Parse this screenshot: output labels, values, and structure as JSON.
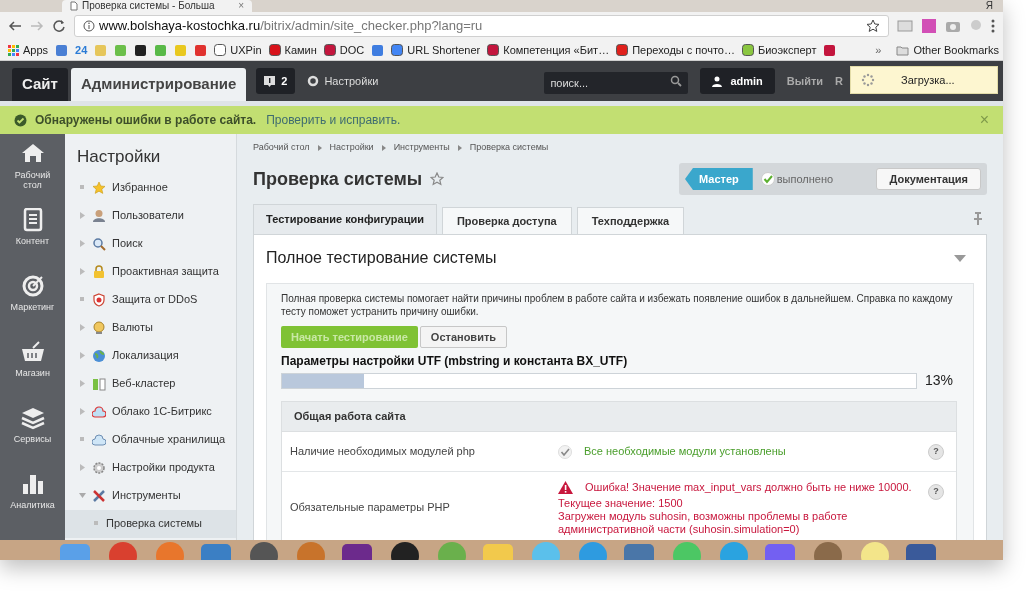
{
  "browser": {
    "tab_title": "Проверка системы - Больша",
    "tab_close": "×",
    "profile_letter": "Я",
    "url_host": "www.bolshaya-kostochka.ru",
    "url_path": "/bitrix/admin/site_checker.php?lang=ru"
  },
  "bookmarks": [
    {
      "kind": "apps",
      "label": "Apps"
    },
    {
      "kind": "icon",
      "color": "#4a7fd4"
    },
    {
      "kind": "text",
      "label": "24",
      "color": "#2a7bd6"
    },
    {
      "kind": "icon",
      "color": "#e6c65a"
    },
    {
      "kind": "icon",
      "color": "#6cbf4a"
    },
    {
      "kind": "icon",
      "color": "#222222"
    },
    {
      "kind": "icon",
      "color": "#59b947"
    },
    {
      "kind": "icon",
      "color": "#e9c81e"
    },
    {
      "kind": "icon",
      "color": "#e0322e"
    },
    {
      "kind": "link",
      "label": "UXPin",
      "color": "#ffffff"
    },
    {
      "kind": "link",
      "label": "Камин",
      "color": "#d8121a"
    },
    {
      "kind": "link",
      "label": "DOC",
      "color": "#c3153d"
    },
    {
      "kind": "icon",
      "color": "#3f7de0"
    },
    {
      "kind": "link",
      "label": "URL Shortener",
      "color": "#4285f4"
    },
    {
      "kind": "link",
      "label": "Компетенция «Бит…",
      "color": "#c3153d"
    },
    {
      "kind": "link",
      "label": "Переходы с почто…",
      "color": "#e0201c"
    },
    {
      "kind": "link",
      "label": "Биоэксперт",
      "color": "#8ac640"
    },
    {
      "kind": "icon",
      "color": "#c3153d"
    }
  ],
  "bookmarks_more": "»",
  "other_bookmarks": "Other Bookmarks",
  "admin_bar": {
    "tabs": [
      {
        "label": "Сайт",
        "selected": false
      },
      {
        "label": "Администрирование",
        "selected": true
      }
    ],
    "notifications": "2",
    "settings": "Настройки",
    "search": {
      "placeholder": "поиск..."
    },
    "user": "admin",
    "logout": "Выйти",
    "cut_text": "R",
    "loading": "Загрузка..."
  },
  "alert": {
    "text": "Обнаружены ошибки в работе сайта.",
    "link": "Проверить и исправить.",
    "close": "×"
  },
  "nav": [
    {
      "kind": "home",
      "label": "Рабочий стол"
    },
    {
      "kind": "content",
      "label": "Контент"
    },
    {
      "kind": "target",
      "label": "Маркетинг"
    },
    {
      "kind": "basket",
      "label": "Магазин"
    },
    {
      "kind": "layers",
      "label": "Сервисы"
    },
    {
      "kind": "chart",
      "label": "Аналитика"
    }
  ],
  "menu": {
    "title": "Настройки",
    "items": [
      {
        "label": "Избранное",
        "kind": "leaf",
        "selected": false
      },
      {
        "label": "Пользователи",
        "kind": "folder",
        "expanded": false,
        "selected": false
      },
      {
        "label": "Поиск",
        "kind": "folder",
        "expanded": false,
        "selected": false
      },
      {
        "label": "Проактивная защита",
        "kind": "folder",
        "expanded": false,
        "selected": false
      },
      {
        "label": "Защита от DDoS",
        "kind": "leaf",
        "selected": false
      },
      {
        "label": "Валюты",
        "kind": "folder",
        "expanded": false,
        "selected": false
      },
      {
        "label": "Локализация",
        "kind": "folder",
        "expanded": false,
        "selected": false
      },
      {
        "label": "Веб-кластер",
        "kind": "folder",
        "expanded": false,
        "selected": false
      },
      {
        "label": "Облако 1С-Битрикс",
        "kind": "folder",
        "expanded": false,
        "selected": false
      },
      {
        "label": "Облачные хранилища",
        "kind": "leaf",
        "selected": false
      },
      {
        "label": "Настройки продукта",
        "kind": "folder",
        "expanded": false,
        "selected": false
      },
      {
        "label": "Инструменты",
        "kind": "folder",
        "expanded": true,
        "selected": false,
        "children": [
          {
            "label": "Проверка системы",
            "kind": "leaf",
            "selected": true
          }
        ]
      }
    ]
  },
  "breadcrumbs": [
    "Рабочий стол",
    "Настройки",
    "Инструменты",
    "Проверка системы"
  ],
  "page_title": "Проверка системы",
  "wizard": {
    "master": "Мастер",
    "status": "выполнено",
    "docs": "Документация"
  },
  "tabs": [
    {
      "label": "Тестирование конфигурации",
      "selected": true
    },
    {
      "label": "Проверка доступа",
      "selected": false
    },
    {
      "label": "Техподдержка",
      "selected": false
    }
  ],
  "section": {
    "title": "Полное тестирование системы",
    "description": "Полная проверка системы помогает найти причины проблем в работе сайта и избежать появление ошибок в дальнейшем. Справка по каждому тесту поможет устранить причину ошибки.",
    "buttons": [
      {
        "label": "Начать тестирование",
        "kind": "primary",
        "disabled": true
      },
      {
        "label": "Остановить",
        "kind": "secondary",
        "disabled": false
      }
    ],
    "progress": {
      "label": "Параметры настройки UTF (mbstring и константа BX_UTF)",
      "level": 0.13,
      "reading": "13%"
    },
    "table": {
      "group": "Общая работа сайта",
      "rows": [
        {
          "name": "Наличие необходимых модулей php",
          "kind": "ok",
          "messages": [
            "Все необходимые модули установлены"
          ],
          "help": "?"
        },
        {
          "name": "Обязательные параметры PHP",
          "kind": "error",
          "messages": [
            "Ошибка! Значение max_input_vars должно быть не ниже 10000.",
            "Текущее значение: 1500",
            "Загружен модуль suhosin, возможны проблемы в работе административной части (suhosin.simulation=0)"
          ],
          "help": "?"
        }
      ]
    }
  }
}
